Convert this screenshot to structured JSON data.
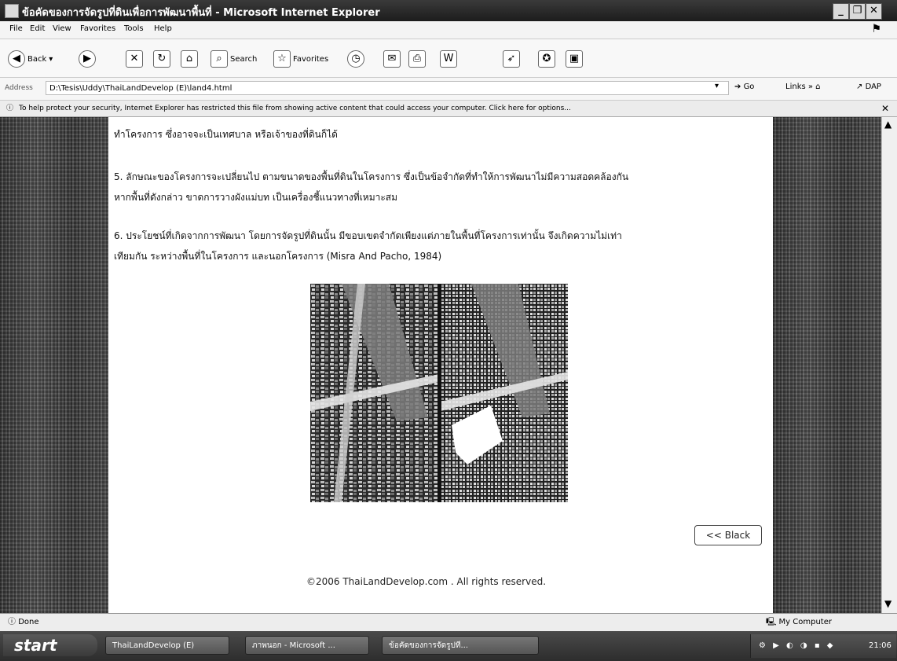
{
  "window": {
    "title": "ข้อคัดของการจัดรูปที่ดินเพื่อการพัฒนาพื้นที่ - Microsoft Internet Explorer"
  },
  "menu": [
    "File",
    "Edit",
    "View",
    "Favorites",
    "Tools",
    "Help"
  ],
  "toolbar": {
    "back_label": "Back",
    "search_label": "Search",
    "favorites_label": "Favorites"
  },
  "address": {
    "label": "Address",
    "value": "D:\\Tesis\\Uddy\\ThaiLandDevelop (E)\\land4.html",
    "go_label": "Go",
    "links_label": "Links",
    "dap_label": "DAP"
  },
  "infobar": {
    "message": "To help protect your security, Internet Explorer has restricted this file from showing active content that could access your computer. Click here for options..."
  },
  "content": {
    "para_top": "ทำโครงการ ซึ่งอาจจะเป็นเทศบาล หรือเจ้าของที่ดินก็ได้",
    "para5_line1": "5.  ลักษณะของโครงการจะเปลี่ยนไป  ตามขนาดของพื้นที่ดินในโครงการ  ซึ่งเป็นข้อจำกัดที่ทำให้การพัฒนาไม่มีความสอดคล้องกัน",
    "para5_line2": "หากพื้นที่ดังกล่าว ขาดการวางผังแม่บท เป็นเครื่องชี้แนวทางที่เหมาะสม",
    "para6_line1": "6.  ประโยชน์ที่เกิดจากการพัฒนา  โดยการจัดรูปที่ดินนั้น  มีขอบเขตจำกัดเพียงแต่ภายในพื้นที่โครงการเท่านั้น  จึงเกิดความไม่เท่า",
    "para6_line2": "เทียมกัน ระหว่างพื้นที่ในโครงการ และนอกโครงการ (Misra And Pacho, 1984)",
    "back_button": "<< Black",
    "footer": "©2006 ThaiLandDevelop.com . All rights reserved."
  },
  "status": {
    "left": "Done",
    "zone": "My Computer"
  },
  "taskbar": {
    "start": "start",
    "tasks": [
      "ThaiLandDevelop (E)",
      "ภาพนอก - Microsoft ...",
      "ข้อคัดของการจัดรูปที..."
    ],
    "clock": "21:06"
  },
  "icons": {
    "app": "ie-page-icon",
    "back": "back-arrow-icon",
    "forward": "forward-arrow-icon",
    "stop": "stop-icon",
    "refresh": "refresh-icon",
    "home": "home-icon",
    "search": "search-icon",
    "favorites": "favorites-star-icon",
    "history": "history-icon"
  }
}
